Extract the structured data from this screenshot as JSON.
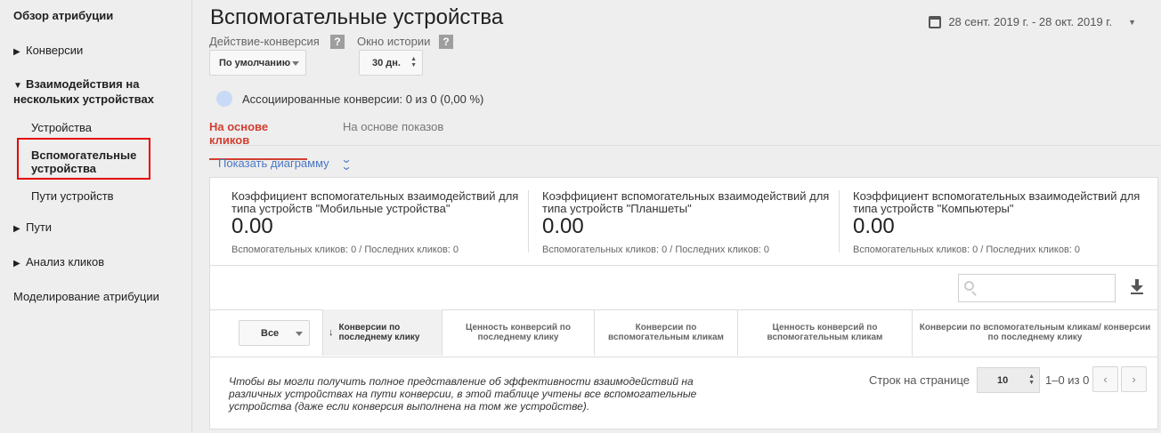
{
  "sidebar": {
    "overview": "Обзор атрибуции",
    "conversions": "Конверсии",
    "cross_device": "Взаимодействия на нескольких устройствах",
    "devices": "Устройства",
    "assisting_devices": "Вспомогательные устройства",
    "device_paths": "Пути устройств",
    "paths": "Пути",
    "click_analysis": "Анализ кликов",
    "modeling": "Моделирование атрибуции",
    "triangle_right": "▶",
    "triangle_down": "▼"
  },
  "header": {
    "title": "Вспомогательные устройства",
    "date_range": "28 сент. 2019 г. - 28 окт. 2019 г."
  },
  "filters": {
    "conversion_label": "Действие-конверсия",
    "conversion_value": "По умолчанию",
    "lookback_label": "Окно истории",
    "lookback_value": "30 дн.",
    "help": "?"
  },
  "assoc_conversions": "Ассоциированные конверсии: 0 из 0 (0,00 %)",
  "tabs": {
    "clicks": "На основе кликов",
    "impressions": "На основе показов"
  },
  "show_chart": "Показать диаграмму",
  "metrics": [
    {
      "title": "Коэффициент вспомогательных взаимодействий для типа устройств \"Мобильные устройства\"",
      "value": "0.00",
      "sub": "Вспомогательных кликов: 0 / Последних кликов: 0"
    },
    {
      "title": "Коэффициент вспомогательных взаимодействий для типа устройств \"Планшеты\"",
      "value": "0.00",
      "sub": "Вспомогательных кликов: 0 / Последних кликов: 0"
    },
    {
      "title": "Коэффициент вспомогательных взаимодействий для типа устройств \"Компьютеры\"",
      "value": "0.00",
      "sub": "Вспомогательных кликов: 0 / Последних кликов: 0"
    }
  ],
  "table": {
    "filter_value": "Все",
    "columns": [
      "Конверсии по последнему клику",
      "Ценность конверсий по последнему клику",
      "Конверсии по вспомогательным кликам",
      "Ценность конверсий по вспомогательным кликам",
      "Конверсии по вспомогательным кликам/ конверсии по последнему клику"
    ],
    "sort_arrow": "↓",
    "note": "Чтобы вы могли получить полное представление об эффективности взаимодействий на различных устройствах на пути конверсии, в этой таблице учтены все вспомогательные устройства (даже если конверсия выполнена на том же устройстве).",
    "rows_label": "Строк на странице",
    "rows_value": "10",
    "range": "1–0 из 0",
    "prev": "‹",
    "next": "›"
  }
}
